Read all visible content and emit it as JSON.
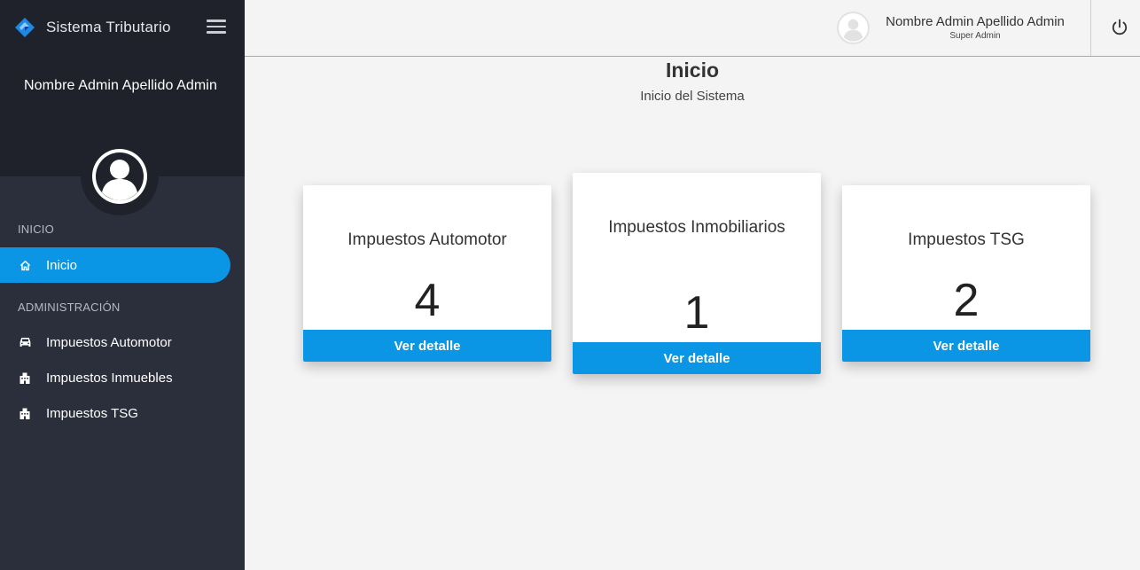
{
  "app": {
    "brand": "Sistema Tributario"
  },
  "sidebar": {
    "user_name": "Nombre Admin Apellido Admin",
    "sections": [
      {
        "label": "INICIO",
        "items": [
          {
            "label": "Inicio",
            "icon": "home-icon",
            "active": true
          }
        ]
      },
      {
        "label": "ADMINISTRACIÓN",
        "items": [
          {
            "label": "Impuestos Automotor",
            "icon": "car-icon"
          },
          {
            "label": "Impuestos Inmuebles",
            "icon": "building-icon"
          },
          {
            "label": "Impuestos TSG",
            "icon": "building-icon"
          }
        ]
      }
    ]
  },
  "header": {
    "user_name": "Nombre Admin Apellido Admin",
    "user_role": "Super Admin"
  },
  "main": {
    "title": "Inicio",
    "subtitle": "Inicio del Sistema",
    "cards": [
      {
        "title": "Impuestos Automotor",
        "count": "4",
        "button": "Ver detalle"
      },
      {
        "title": "Impuestos Inmobiliarios",
        "count": "1",
        "button": "Ver detalle"
      },
      {
        "title": "Impuestos TSG",
        "count": "2",
        "button": "Ver detalle"
      }
    ]
  },
  "colors": {
    "accent": "#0b96e5",
    "sidebar_bg": "#2b2f3b",
    "sidebar_top_bg": "#1f222b",
    "page_bg": "#f4f4f4"
  }
}
